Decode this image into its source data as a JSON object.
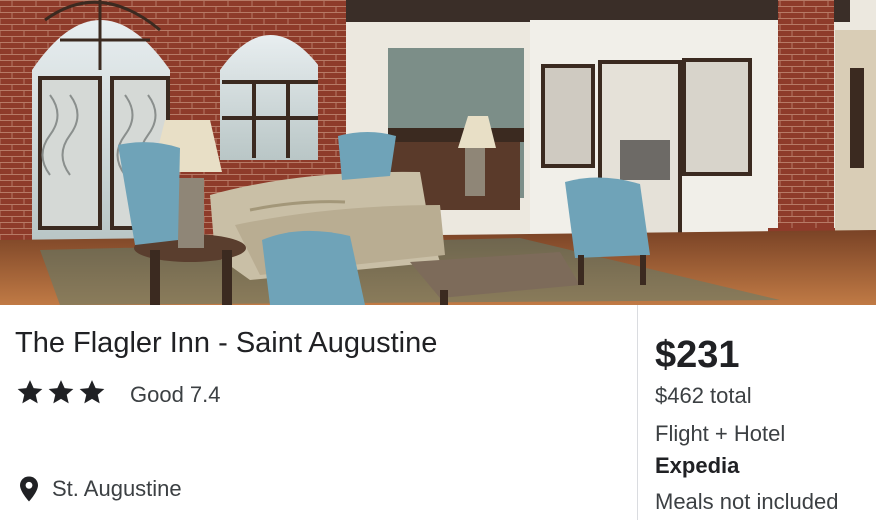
{
  "hotel": {
    "name": "The Flagler Inn - Saint Augustine",
    "star_class": 3,
    "rating_text": "Good 7.4",
    "location": "St. Augustine",
    "photo_icon": "hotel-lobby-photo"
  },
  "pricing": {
    "price": "$231",
    "total": "$462 total",
    "package": "Flight + Hotel",
    "provider": "Expedia",
    "meals": "Meals not included"
  },
  "icons": {
    "star": "star-icon",
    "location": "location-pin-icon"
  },
  "colors": {
    "text_primary": "#202124",
    "text_secondary": "#3c4043",
    "divider": "#dadce0",
    "brick": "#8e3b2a",
    "chair_blue": "#6fa3b8"
  }
}
